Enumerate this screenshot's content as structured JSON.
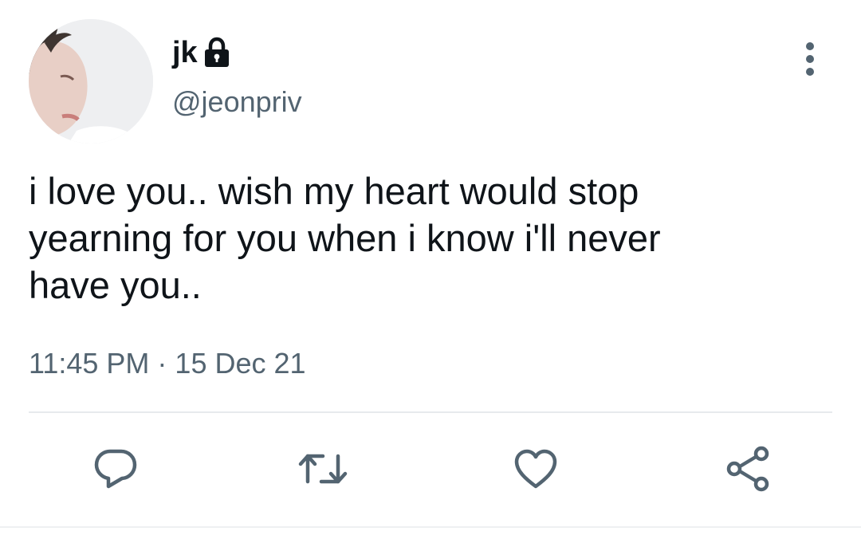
{
  "user": {
    "display_name": "jk",
    "handle": "@jeonpriv",
    "protected_icon": "lock-icon",
    "avatar": "profile-photo"
  },
  "tweet": {
    "text": "i love you.. wish my heart would stop\nyearning for you when i know i'll never\nhave you..",
    "time": "11:45 PM",
    "separator": "·",
    "date": "15 Dec 21"
  },
  "actions": {
    "icons": [
      "reply-icon",
      "retweet-icon",
      "like-icon",
      "share-icon"
    ],
    "more_icon": "more-vertical-icon",
    "icon_color": "#536471"
  },
  "colors": {
    "text_primary": "#0f1419",
    "text_secondary": "#536471",
    "divider": "#e7eaed"
  }
}
